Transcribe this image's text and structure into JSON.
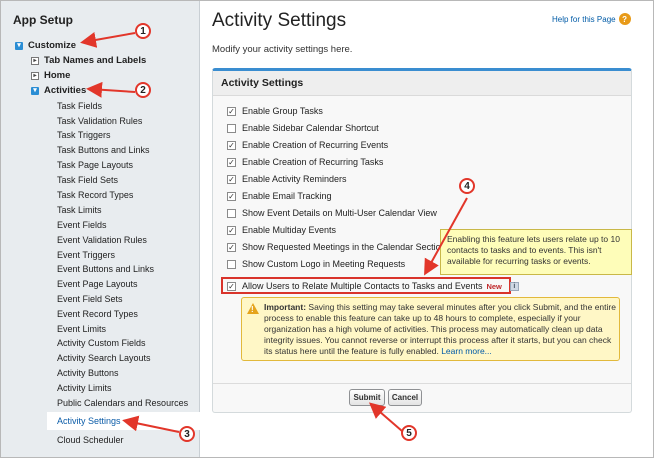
{
  "sidebar": {
    "title": "App Setup",
    "customize": "Customize",
    "tab_names": "Tab Names and Labels",
    "home": "Home",
    "activities": "Activities",
    "items": [
      "Task Fields",
      "Task Validation Rules",
      "Task Triggers",
      "Task Buttons and Links",
      "Task Page Layouts",
      "Task Field Sets",
      "Task Record Types",
      "Task Limits",
      "Event Fields",
      "Event Validation Rules",
      "Event Triggers",
      "Event Buttons and Links",
      "Event Page Layouts",
      "Event Field Sets",
      "Event Record Types",
      "Event Limits",
      "Activity Custom Fields",
      "Activity Search Layouts",
      "Activity Buttons",
      "Activity Limits",
      "Public Calendars and Resources",
      "Activity Settings",
      "Cloud Scheduler"
    ]
  },
  "header": {
    "title": "Activity Settings",
    "help_link": "Help for this Page",
    "subtitle": "Modify your activity settings here."
  },
  "panel": {
    "title": "Activity Settings",
    "options": [
      {
        "label": "Enable Group Tasks",
        "checked": true
      },
      {
        "label": "Enable Sidebar Calendar Shortcut",
        "checked": false
      },
      {
        "label": "Enable Creation of Recurring Events",
        "checked": true
      },
      {
        "label": "Enable Creation of Recurring Tasks",
        "checked": true
      },
      {
        "label": "Enable Activity Reminders",
        "checked": true
      },
      {
        "label": "Enable Email Tracking",
        "checked": true
      },
      {
        "label": "Show Event Details on Multi-User Calendar View",
        "checked": false
      },
      {
        "label": "Enable Multiday Events",
        "checked": true
      },
      {
        "label": "Show Requested Meetings in the Calendar Section",
        "checked": true
      },
      {
        "label": "Show Custom Logo in Meeting Requests",
        "checked": false
      }
    ],
    "allow_multi": {
      "label": "Allow Users to Relate Multiple Contacts to Tasks and Events",
      "checked": true,
      "badge": "New"
    },
    "tooltip": "Enabling this feature lets users relate up to 10 contacts to tasks and to events. This isn't available for recurring tasks or events.",
    "warning": {
      "heading": "Important:",
      "body": "Saving this setting may take several minutes after you click Submit, and the entire process to enable this feature can take up to 48 hours to complete, especially if your organization has a high volume of activities. This process may automatically clean up data integrity issues. You cannot reverse or interrupt this process after it starts, but you can check its status here until the feature is fully enabled.",
      "link": "Learn more..."
    },
    "submit": "Submit",
    "cancel": "Cancel"
  },
  "callouts": [
    "1",
    "2",
    "3",
    "4",
    "5"
  ],
  "colors": {
    "accent": "#3a8dd0",
    "callout": "#e2362a",
    "link": "#015ba7"
  }
}
